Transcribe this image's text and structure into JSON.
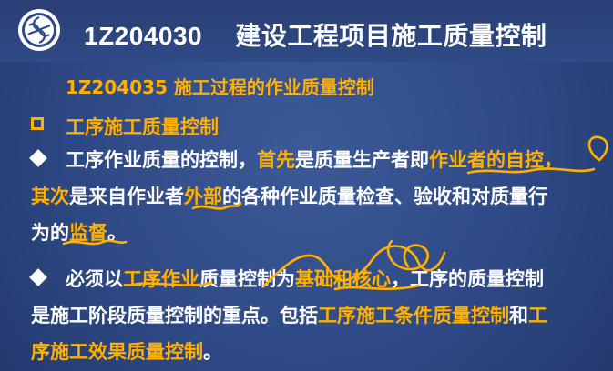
{
  "header": {
    "code": "1Z204030",
    "title": "建设工程项目施工质量控制"
  },
  "subtitle": "1Z204035 施工过程的作业质量控制",
  "section": {
    "heading": "工序施工质量控制"
  },
  "p1": {
    "a": "工序作业质量的控制，",
    "b": "首先",
    "c": "是质量生产者即",
    "d": "作业者的自控",
    "e": "，",
    "f": "其次",
    "g": "是来自作业者",
    "h": "外部",
    "i": "的各种作业质量检查、验收和对质量行",
    "j": "为的",
    "k": "监督",
    "l": "。"
  },
  "p2": {
    "a": "必须以",
    "b": "工序作业",
    "c": "质量控制为",
    "d": "基础和核心",
    "e": "，工序的质量控制",
    "f": "是施工阶段质量控制的重点。包括",
    "g": "工序施工条件质量控制",
    "h": "和",
    "i": "工",
    "j": "序施工效果质量控制",
    "k": "。"
  },
  "colors": {
    "background": "#2f4a86",
    "accent": "#ffb000",
    "text": "#ffffff"
  },
  "icons": {
    "logo": "seal-logo-icon",
    "bullet_box": "square-bullet-icon",
    "bullet_diamond": "diamond-bullet-icon"
  }
}
